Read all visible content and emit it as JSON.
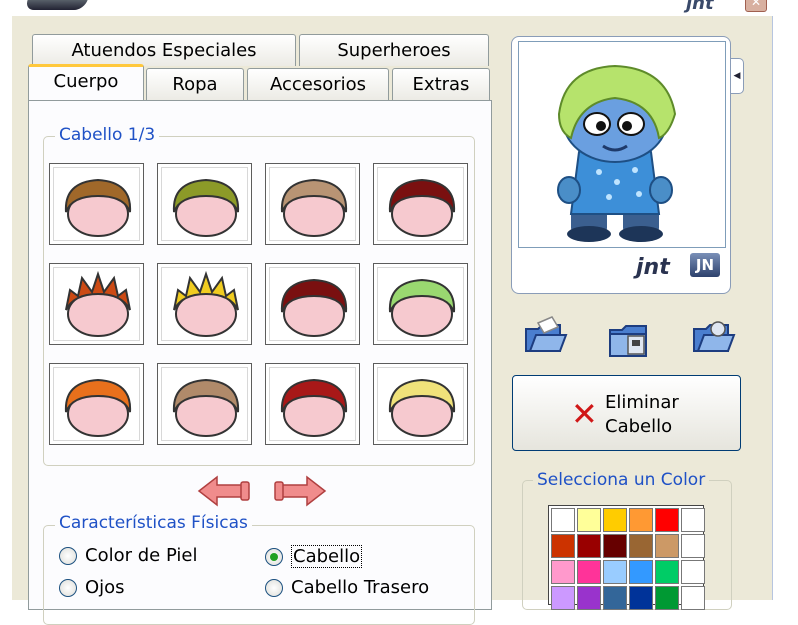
{
  "window": {
    "brand": "jnt",
    "close_icon": "close-icon"
  },
  "tabs_top": [
    "Atuendos Especiales",
    "Superheroes"
  ],
  "tabs_bottom": [
    "Cuerpo",
    "Ropa",
    "Accesorios",
    "Extras"
  ],
  "active_tab": "Cuerpo",
  "hair_group": {
    "label": "Cabello 1/3"
  },
  "hair_styles": [
    {
      "name": "hair-style-1",
      "color": "#a0682a"
    },
    {
      "name": "hair-style-2",
      "color": "#8c9a28"
    },
    {
      "name": "hair-style-3",
      "color": "#b89474"
    },
    {
      "name": "hair-style-4",
      "color": "#7a1010"
    },
    {
      "name": "hair-style-5",
      "color": "#cc4a14"
    },
    {
      "name": "hair-style-6",
      "color": "#f0cc20"
    },
    {
      "name": "hair-style-7",
      "color": "#7a1010"
    },
    {
      "name": "hair-style-8",
      "color": "#9ad870"
    },
    {
      "name": "hair-style-9",
      "color": "#e8701c"
    },
    {
      "name": "hair-style-10",
      "color": "#b08a6a"
    },
    {
      "name": "hair-style-11",
      "color": "#a81818"
    },
    {
      "name": "hair-style-12",
      "color": "#f0e27a"
    }
  ],
  "features_group": {
    "label": "Características Físicas",
    "options": [
      {
        "label": "Color de Piel",
        "checked": false
      },
      {
        "label": "Cabello",
        "checked": true
      },
      {
        "label": "Ojos",
        "checked": false
      },
      {
        "label": "Cabello Trasero",
        "checked": false
      }
    ]
  },
  "preview": {
    "brand": "jnt",
    "brand_logo": "JN"
  },
  "delete_button": {
    "line1": "Eliminar",
    "line2": "Cabello"
  },
  "color_group": {
    "label": "Selecciona un Color",
    "swatches": [
      "#ffffff",
      "#ffff99",
      "#ffcc00",
      "#ff9933",
      "#ff0000",
      "#ffffff",
      "#cc3300",
      "#990000",
      "#660000",
      "#996633",
      "#cc9966",
      "#ffffff",
      "#ff99cc",
      "#ff3399",
      "#99ccff",
      "#3399ff",
      "#00cc66",
      "#ffffff",
      "#cc99ff",
      "#9933cc",
      "#336699",
      "#003399",
      "#009933",
      "#ffffff"
    ]
  }
}
